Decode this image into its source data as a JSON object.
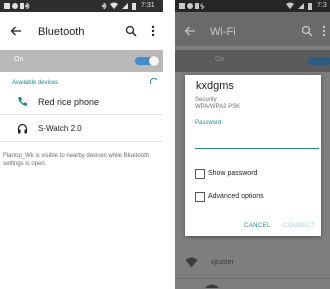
{
  "left_screen": {
    "status_time": "7:31",
    "title": "Bluetooth",
    "toggle_label": "On",
    "section_header": "Available devices",
    "devices": [
      {
        "name": "Red rice phone",
        "icon": "phone-icon"
      },
      {
        "name": "S-Watch 2.0",
        "icon": "headphones-icon"
      }
    ],
    "footnote": "Flartop_Wk is visible to nearby devices while Bluetooth settings is open."
  },
  "right_screen": {
    "status_time": "7:3",
    "title": "Wi-Fi",
    "toggle_label": "On",
    "network_background": "xjruster",
    "dialog": {
      "network_name": "kxdgms",
      "security_label": "Security",
      "security_value": "WPA/WPA2 PSK",
      "password_label": "Password",
      "show_password_label": "Show password",
      "advanced_options_label": "Advanced options",
      "cancel_label": "CANCEL",
      "connect_label": "CONNECT"
    }
  },
  "colors": {
    "accent": "#1c8b8b",
    "toggle_on": "#3f8fd0"
  }
}
